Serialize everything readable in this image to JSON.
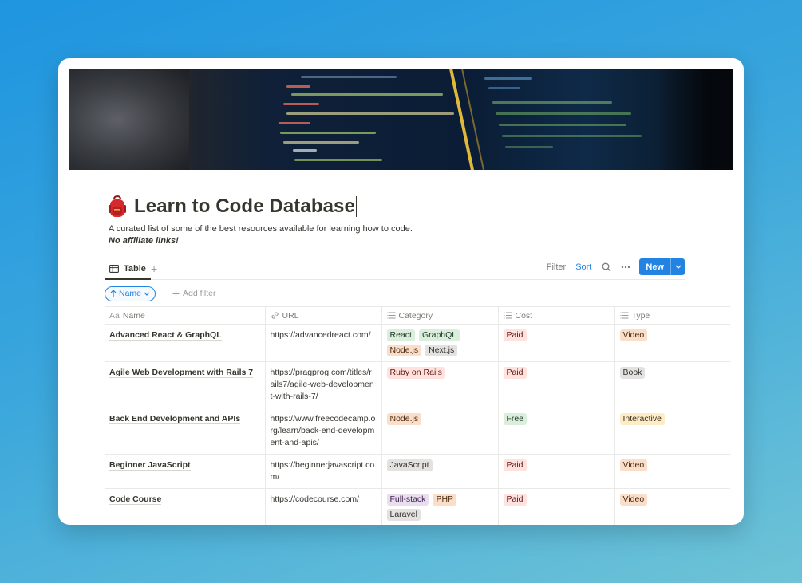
{
  "page": {
    "title": "Learn to Code Database",
    "description": "A curated list of some of the best resources available for learning how to code.",
    "note": "No affiliate links!"
  },
  "views": {
    "active_tab": "Table",
    "add_view": "+"
  },
  "toolbar": {
    "filter": "Filter",
    "sort": "Sort",
    "new": "New"
  },
  "filters": {
    "sort_pill": "Name",
    "add_filter": "Add filter"
  },
  "columns": {
    "name": "Name",
    "name_prefix": "Aa",
    "url": "URL",
    "category": "Category",
    "cost": "Cost",
    "type": "Type"
  },
  "rows": [
    {
      "name": "Advanced React & GraphQL",
      "url": "https://advancedreact.com/",
      "category": [
        {
          "label": "React",
          "color": "green"
        },
        {
          "label": "GraphQL",
          "color": "green"
        },
        {
          "label": "Node.js",
          "color": "orange"
        },
        {
          "label": "Next.js",
          "color": "gray"
        }
      ],
      "cost": {
        "label": "Paid",
        "color": "red"
      },
      "type": {
        "label": "Video",
        "color": "orange"
      }
    },
    {
      "name": "Agile Web Development with Rails 7",
      "url": "https://pragprog.com/titles/rails7/agile-web-development-with-rails-7/",
      "category": [
        {
          "label": "Ruby on Rails",
          "color": "red"
        }
      ],
      "cost": {
        "label": "Paid",
        "color": "red"
      },
      "type": {
        "label": "Book",
        "color": "gray"
      }
    },
    {
      "name": "Back End Development and APIs",
      "url": "https://www.freecodecamp.org/learn/back-end-development-and-apis/",
      "category": [
        {
          "label": "Node.js",
          "color": "orange"
        }
      ],
      "cost": {
        "label": "Free",
        "color": "green"
      },
      "type": {
        "label": "Interactive",
        "color": "yellow"
      }
    },
    {
      "name": "Beginner JavaScript",
      "url": "https://beginnerjavascript.com/",
      "category": [
        {
          "label": "JavaScript",
          "color": "gray"
        }
      ],
      "cost": {
        "label": "Paid",
        "color": "red"
      },
      "type": {
        "label": "Video",
        "color": "orange"
      }
    },
    {
      "name": "Code Course",
      "url": "https://codecourse.com/",
      "category": [
        {
          "label": "Full-stack",
          "color": "purple"
        },
        {
          "label": "PHP",
          "color": "orange"
        },
        {
          "label": "Laravel",
          "color": "gray"
        }
      ],
      "cost": {
        "label": "Paid",
        "color": "red"
      },
      "type": {
        "label": "Video",
        "color": "orange"
      }
    }
  ],
  "colors": {
    "accent": "#2383e2",
    "background_start": "#1f95e0",
    "background_end": "#6ec3d6"
  }
}
